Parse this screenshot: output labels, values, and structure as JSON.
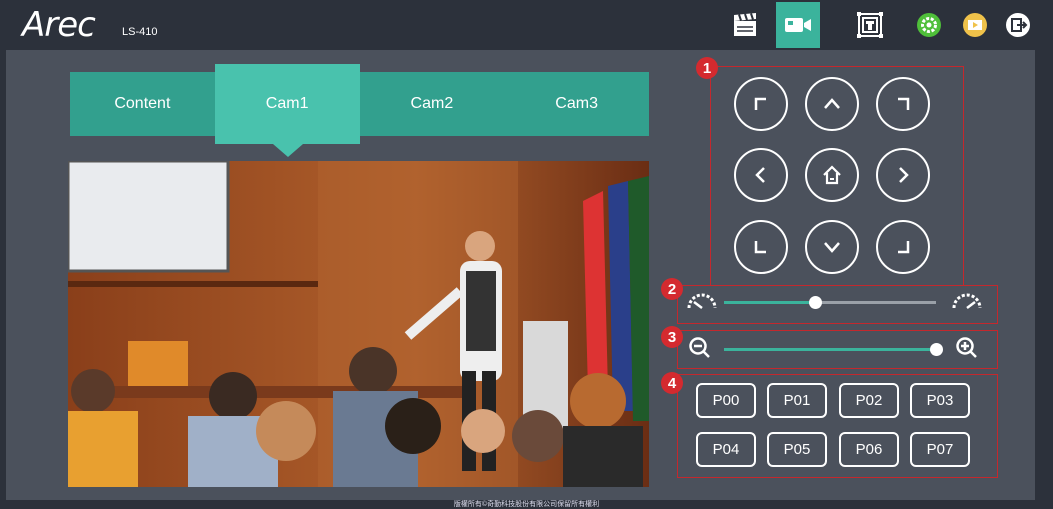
{
  "brand": {
    "logo": "Arec",
    "model": "LS-410"
  },
  "toolbar": [
    {
      "name": "clapperboard-icon"
    },
    {
      "name": "camera-icon",
      "active": true
    },
    {
      "name": "layout-icon"
    },
    {
      "name": "settings-icon"
    },
    {
      "name": "media-icon"
    },
    {
      "name": "logout-icon"
    }
  ],
  "tabs": [
    {
      "label": "Content",
      "active": false
    },
    {
      "label": "Cam1",
      "active": true
    },
    {
      "label": "Cam2",
      "active": false
    },
    {
      "label": "Cam3",
      "active": false
    }
  ],
  "sections": {
    "ptz": "1",
    "speed": "2",
    "zoom": "3",
    "presets": "4"
  },
  "speed": {
    "value": 0.43
  },
  "zoom": {
    "value": 1.0
  },
  "presets": [
    "P00",
    "P01",
    "P02",
    "P03",
    "P04",
    "P05",
    "P06",
    "P07"
  ],
  "footer": "版權所有©奇勤科技股份有限公司保留所有權利"
}
